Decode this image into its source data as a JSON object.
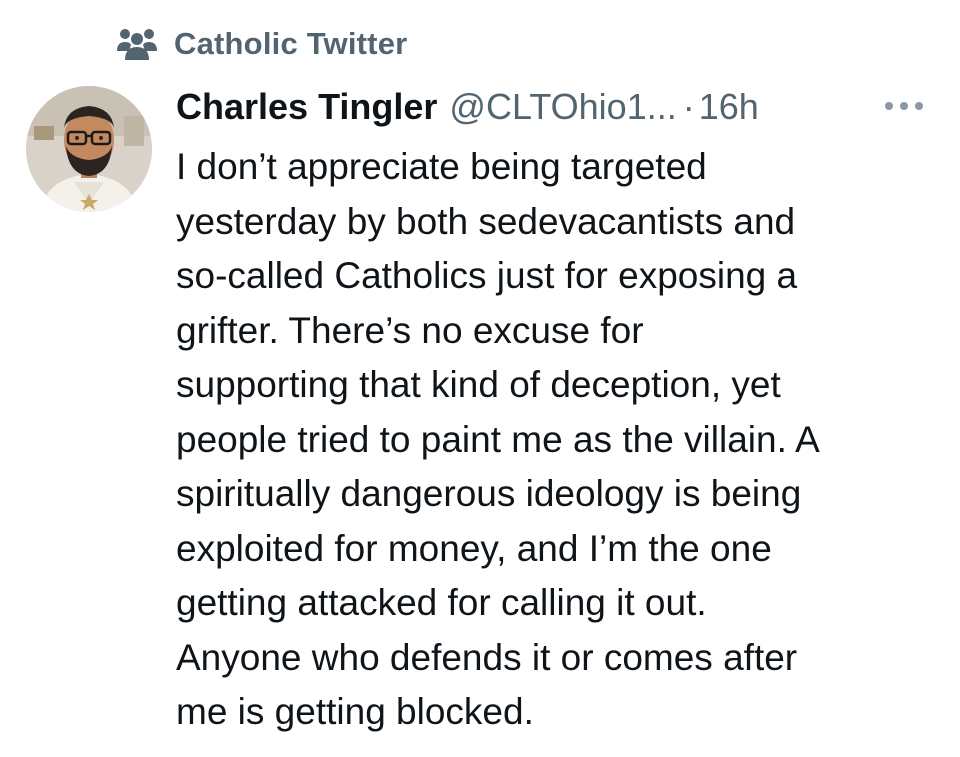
{
  "context": {
    "icon": "community-icon",
    "label": "Catholic Twitter"
  },
  "tweet": {
    "author": {
      "display_name": "Charles Tingler",
      "handle": "@CLTOhio1...",
      "avatar": "profile-photo"
    },
    "separator": "·",
    "timestamp": "16h",
    "more_icon": "more-horizontal-icon",
    "text_lines": [
      "I don’t appreciate being targeted",
      "yesterday by both sedevacantists and",
      "so-called Catholics just for exposing a",
      "grifter. There’s no excuse for",
      "supporting that kind of deception, yet",
      "people tried to paint me as the villain. A",
      "spiritually dangerous ideology is being",
      "exploited for money, and I’m the one",
      "getting attacked for calling it out.",
      "Anyone who defends it or comes after",
      "me is getting blocked."
    ]
  },
  "colors": {
    "primary_text": "#0f1419",
    "secondary_text": "#536471",
    "background": "#ffffff"
  }
}
